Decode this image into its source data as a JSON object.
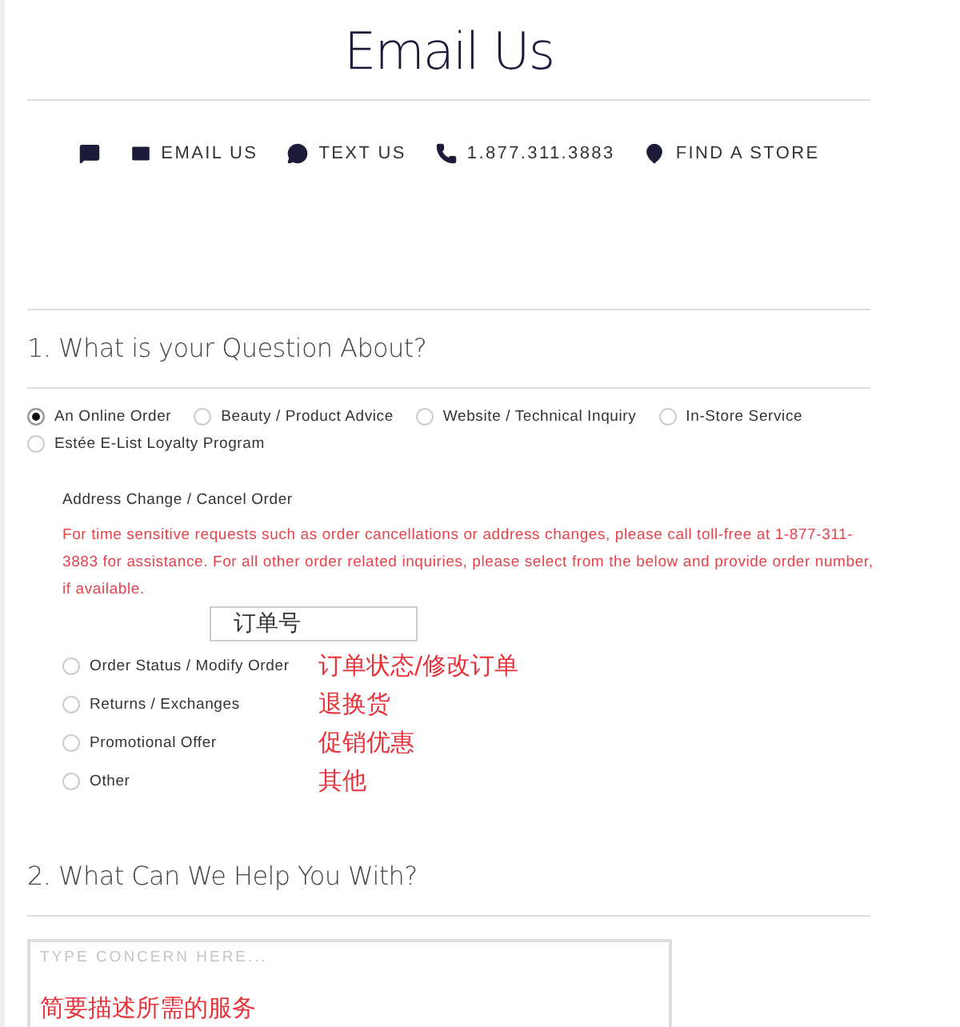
{
  "title": "Email Us",
  "contact_links": [
    {
      "kind": "chat"
    },
    {
      "kind": "email",
      "label": "EMAIL US"
    },
    {
      "kind": "text",
      "label": "TEXT US"
    },
    {
      "kind": "phone",
      "label": "1.877.311.3883"
    },
    {
      "kind": "store",
      "label": "FIND A STORE"
    }
  ],
  "section_1": {
    "heading": "1. What is your Question About?",
    "options": [
      {
        "label": "An Online Order",
        "selected": true
      },
      {
        "label": "Beauty / Product Advice",
        "selected": false
      },
      {
        "label": "Website / Technical Inquiry",
        "selected": false
      },
      {
        "label": "In-Store Service",
        "selected": false
      },
      {
        "label": "Estée E-List Loyalty Program",
        "selected": false
      }
    ],
    "sub_heading": "Address Change / Cancel Order",
    "notice": "For time sensitive requests such as order cancellations or address changes, please call toll-free at 1-877-311-3883 for assistance. For all other order related inquiries, please select from the below and provide order number, if available.",
    "order_number": {
      "value": "订单号"
    },
    "sub_options": [
      {
        "label": "Order Status / Modify Order",
        "selected": false,
        "note": "订单状态/修改订单"
      },
      {
        "label": "Returns / Exchanges",
        "selected": false,
        "note": "退换货"
      },
      {
        "label": "Promotional Offer",
        "selected": false,
        "note": "促销优惠"
      },
      {
        "label": "Other",
        "selected": false,
        "note": "其他"
      }
    ]
  },
  "section_2": {
    "heading": "2. What Can We Help You With?",
    "concern": {
      "placeholder": "TYPE CONCERN HERE...",
      "note": "简要描述所需的服务"
    }
  }
}
